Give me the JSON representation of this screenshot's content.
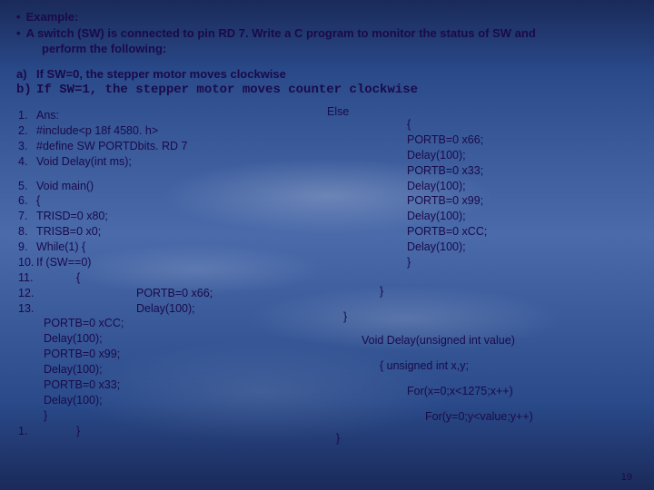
{
  "header": {
    "l1": "Example:",
    "l2": "A switch (SW) is connected to pin RD 7. Write a C program to monitor the status of SW and",
    "l3": "perform the following:"
  },
  "options": {
    "a_lab": "a)",
    "a_txt": "If SW=0, the stepper motor moves clockwise",
    "b_lab": "b)",
    "b_txt": "If SW=1, the stepper motor moves counter clockwise"
  },
  "code": {
    "l1": "Ans:",
    "l2": "#include<p 18f 4580. h>",
    "l3": "#define SW PORTDbits. RD 7",
    "l4": "Void Delay(int ms);",
    "l5": "Void main()",
    "l6": "{",
    "l7": "TRISD=0 x80;",
    "l8": "TRISB=0 x0;",
    "l9": "While(1) {",
    "l10": "If (SW==0)",
    "l11": "{",
    "l12": "PORTB=0 x66;",
    "l13": "Delay(100);",
    "sub1": "PORTB=0 xCC;",
    "sub2": "Delay(100);",
    "sub3": "PORTB=0 x99;",
    "sub4": "Delay(100);",
    "sub5": "PORTB=0 x33;",
    "sub6": "Delay(100);",
    "sub7": "}",
    "btm_num": "1.",
    "btm_close": "}"
  },
  "right": {
    "else": "Else",
    "e1": "{",
    "e2": "PORTB=0 x66;",
    "e3": "Delay(100);",
    "e4": "PORTB=0 x33;",
    "e5": "Delay(100);",
    "e6": "PORTB=0 x99;",
    "e7": "Delay(100);",
    "e8": "PORTB=0 xCC;",
    "e9": "Delay(100);",
    "e10": "}",
    "close1": "}",
    "close2": "}",
    "fn": "Void Delay(unsigned int value)",
    "fn_open": "{ unsigned int x,y;",
    "forx": "For(x=0;x<1275;x++)",
    "fory": "For(y=0;y<value;y++)",
    "fn_close": "}"
  },
  "pagenum": "19"
}
